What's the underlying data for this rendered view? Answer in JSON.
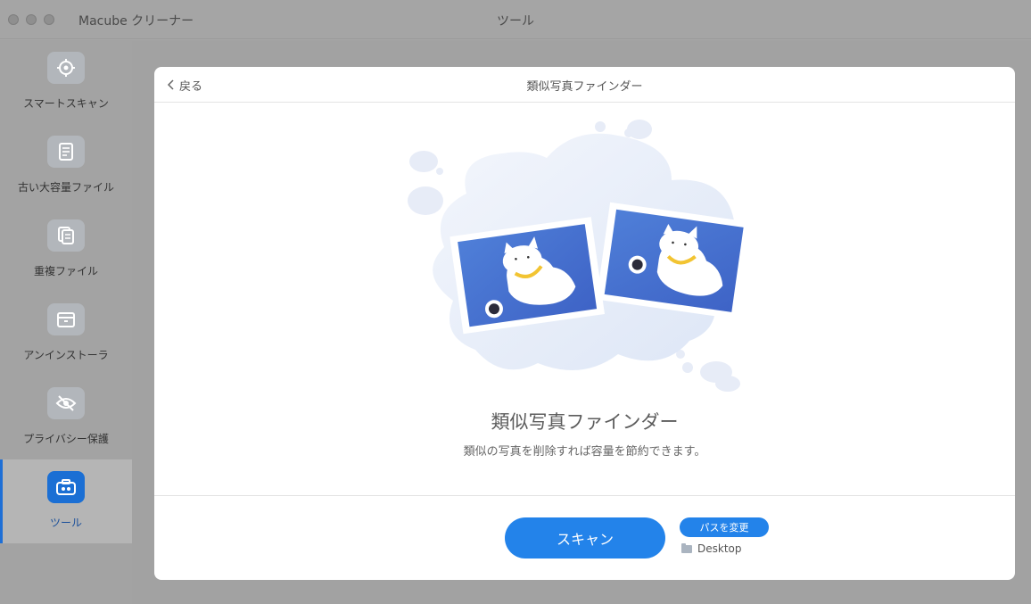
{
  "window": {
    "app_title": "Macube クリーナー",
    "title": "ツール"
  },
  "sidebar": {
    "items": [
      {
        "label": "スマートスキャン",
        "icon": "target-icon"
      },
      {
        "label": "古い大容量ファイル",
        "icon": "document-icon"
      },
      {
        "label": "重複ファイル",
        "icon": "copy-files-icon"
      },
      {
        "label": "アンインストーラ",
        "icon": "box-icon"
      },
      {
        "label": "プライバシー保護",
        "icon": "eye-off-icon"
      },
      {
        "label": "ツール",
        "icon": "toolbox-icon",
        "active": true
      }
    ]
  },
  "panel": {
    "back_label": "戻る",
    "header_title": "類似写真ファインダー",
    "feature_title": "類似写真ファインダー",
    "feature_desc": "類似の写真を削除すれば容量を節約できます。",
    "scan_label": "スキャン",
    "change_path_label": "パスを変更",
    "path": "Desktop"
  },
  "colors": {
    "accent": "#2383ea",
    "active_border": "#1e6fd6"
  }
}
